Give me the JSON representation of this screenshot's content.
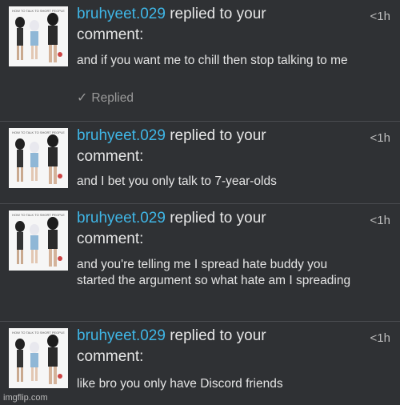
{
  "notifications": [
    {
      "username": "bruhyeet.029",
      "action": " replied to your",
      "action2": "comment:",
      "time": "<1h",
      "body": "and if you want me to chill then stop talking to me",
      "replied_label": "Replied",
      "thumb_caption": "HOW TO TALK TO SHORT PEOPLE"
    },
    {
      "username": "bruhyeet.029",
      "action": " replied to your",
      "action2": "comment:",
      "time": "<1h",
      "body": "and I bet you only talk to 7-year-olds",
      "thumb_caption": "HOW TO TALK TO SHORT PEOPLE"
    },
    {
      "username": "bruhyeet.029",
      "action": " replied to your",
      "action2": "comment:",
      "time": "<1h",
      "body": "and you're telling me I spread hate buddy you started the argument so what hate am I spreading",
      "thumb_caption": "HOW TO TALK TO SHORT PEOPLE"
    },
    {
      "username": "bruhyeet.029",
      "action": " replied to your",
      "action2": "comment:",
      "time": "<1h",
      "body": "like bro you only have Discord friends",
      "thumb_caption": "HOW TO TALK TO SHORT PEOPLE"
    }
  ],
  "watermark": "imgflip.com",
  "icons": {
    "thumbnail": "meme-thumbnail-icon",
    "replied": "check-icon"
  },
  "colors": {
    "username": "#3fb6e6",
    "background": "#2f3134",
    "text": "#e6e6e6"
  }
}
